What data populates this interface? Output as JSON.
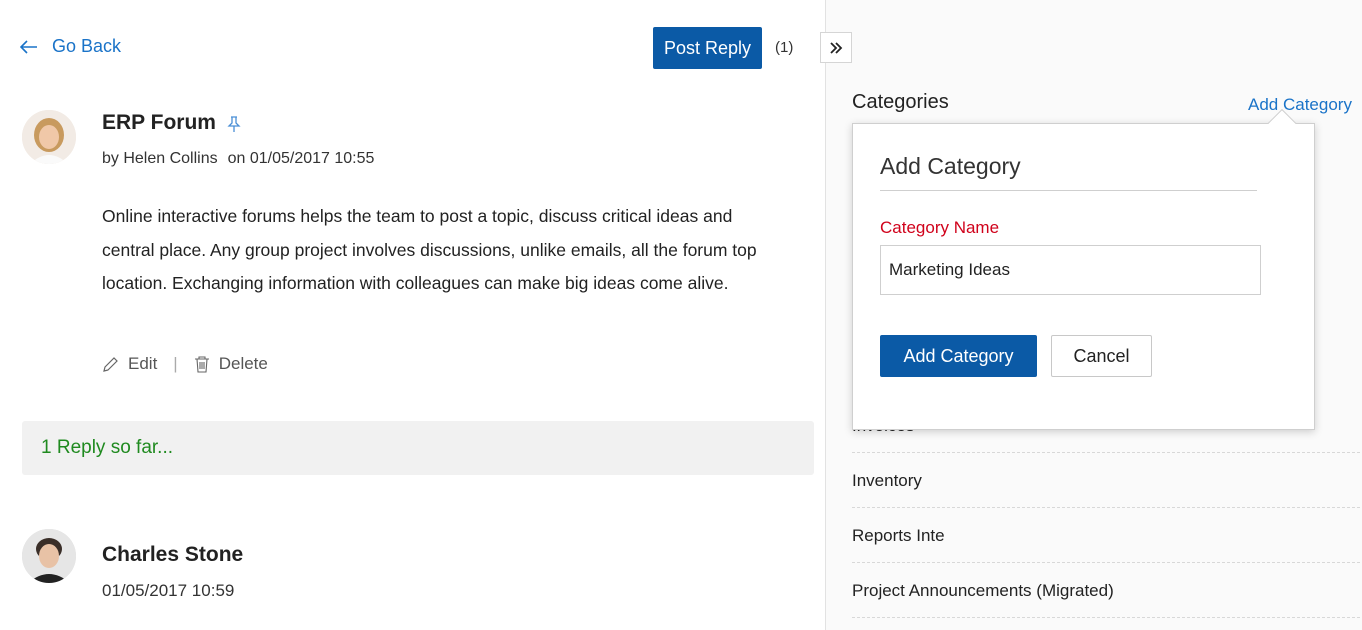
{
  "header": {
    "go_back_label": "Go Back",
    "post_reply_label": "Post Reply",
    "reply_count": "(1)"
  },
  "post": {
    "title": "ERP Forum",
    "author_line": "by Helen Collins",
    "date_line": "on 01/05/2017 10:55",
    "body_lines": [
      "Online interactive forums helps the team to post a topic, discuss critical ideas and",
      "central place. Any group project involves discussions, unlike emails, all the forum top",
      "location. Exchanging information with colleagues can make big ideas come alive."
    ],
    "edit_label": "Edit",
    "separator": "|",
    "delete_label": "Delete"
  },
  "replies": {
    "summary": "1 Reply so far...",
    "items": [
      {
        "name": "Charles Stone",
        "date": "01/05/2017 10:59"
      }
    ]
  },
  "sidebar": {
    "heading": "Categories",
    "add_link": "Add Category",
    "categories": [
      "Invoices",
      "Inventory",
      "Reports Inte",
      "Project Announcements (Migrated)"
    ]
  },
  "popup": {
    "title": "Add Category",
    "field_label": "Category Name",
    "field_value": "Marketing Ideas",
    "submit_label": "Add Category",
    "cancel_label": "Cancel"
  },
  "colors": {
    "accent_blue": "#0b5aa6",
    "link_blue": "#1a73c8",
    "success_green": "#1f8a1f",
    "required_red": "#d0021b"
  }
}
